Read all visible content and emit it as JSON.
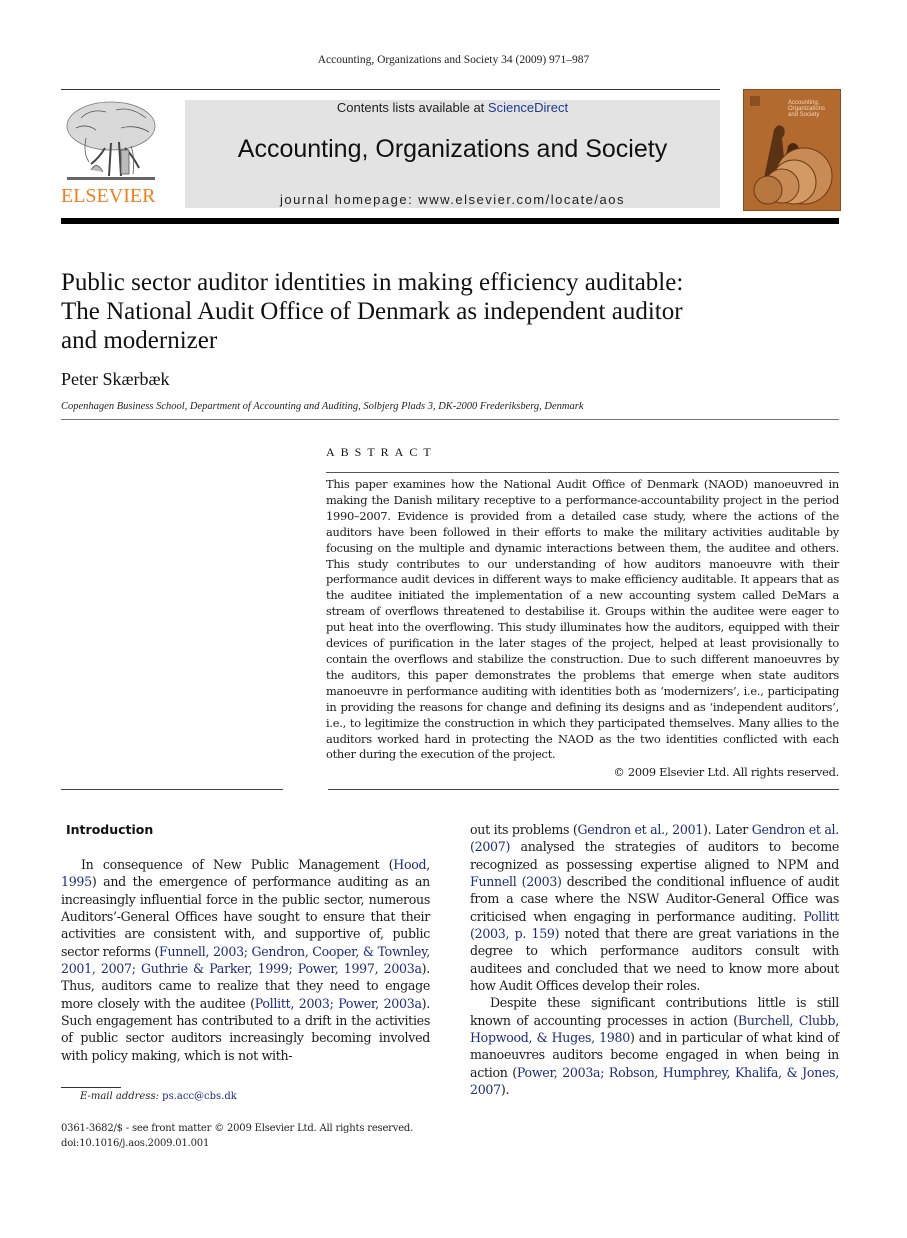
{
  "running_head": "Accounting, Organizations and Society 34 (2009) 971–987",
  "header": {
    "publisher_logo_text": "ELSEVIER",
    "contents_prefix": "Contents lists available at ",
    "contents_link": "ScienceDirect",
    "journal_title": "Accounting, Organizations and Society",
    "homepage": "journal homepage: www.elsevier.com/locate/aos",
    "cover_title": "Accounting, Organizations and Society",
    "colors": {
      "elsevier_orange": "#f07f1b",
      "banner_gray": "#e3e3e3",
      "cover_brown": "#b26a2e",
      "link_blue": "#1d2a80"
    }
  },
  "article": {
    "title_lines": [
      "Public sector auditor identities in making efficiency auditable:",
      "The National Audit Office of Denmark as independent auditor",
      "and modernizer"
    ],
    "author": "Peter Skærbæk",
    "affiliation": "Copenhagen Business School, Department of Accounting and Auditing, Solbjerg Plads 3, DK-2000 Frederiksberg, Denmark"
  },
  "abstract": {
    "heading": "ABSTRACT",
    "text": "This paper examines how the National Audit Office of Denmark (NAOD) manoeuvred in making the Danish military receptive to a performance-accountability project in the period 1990–2007. Evidence is provided from a detailed case study, where the actions of the auditors have been followed in their efforts to make the military activities auditable by focusing on the multiple and dynamic interactions between them, the auditee and others. This study contributes to our understanding of how auditors manoeuvre with their performance audit devices in different ways to make efficiency auditable. It appears that as the auditee initiated the implementation of a new accounting system called DeMars a stream of overflows threatened to destabilise it. Groups within the auditee were eager to put heat into the overflowing. This study illuminates how the auditors, equipped with their devices of purification in the later stages of the project, helped at least provisionally to contain the overflows and stabilize the construction. Due to such different manoeuvres by the auditors, this paper demonstrates the problems that emerge when state auditors manoeuvre in performance auditing with identities both as ‘modernizers’, i.e., participating in providing the reasons for change and defining its designs and as ‘independent auditors’, i.e., to legitimize the construction in which they participated themselves. Many allies to the auditors worked hard in protecting the NAOD as the two identities conflicted with each other during the execution of the project.",
    "copyright": "© 2009 Elsevier Ltd. All rights reserved."
  },
  "introduction": {
    "heading": "Introduction",
    "left_column": [
      {
        "t": "In consequence of New Public Management ("
      },
      {
        "t": "Hood, 1995",
        "cite": true
      },
      {
        "t": ") and the emergence of performance auditing as an increasingly influential force in the public sector, numerous Auditors’-General Offices have sought to ensure that their activities are consistent with, and supportive of, public sector reforms ("
      },
      {
        "t": "Funnell, 2003; Gendron, Cooper, & Townley, 2001, 2007; Guthrie & Parker, 1999; Power, 1997, 2003a",
        "cite": true
      },
      {
        "t": "). Thus, auditors came to realize that they need to engage more closely with the auditee ("
      },
      {
        "t": "Pollitt, 2003; Power, 2003a",
        "cite": true
      },
      {
        "t": "). Such engagement has contributed to a drift in the activities of public sector auditors increasingly becoming involved with policy making, which is not with-"
      }
    ],
    "right_column_p1": [
      {
        "t": "out its problems ("
      },
      {
        "t": "Gendron et al., 2001",
        "cite": true
      },
      {
        "t": "). Later "
      },
      {
        "t": "Gendron et al. (2007)",
        "cite": true
      },
      {
        "t": " analysed the strategies of auditors to become recognized as possessing expertise aligned to NPM and "
      },
      {
        "t": "Funnell (2003)",
        "cite": true
      },
      {
        "t": " described the conditional influence of audit from a case where the NSW Auditor-General Office was criticised when engaging in performance auditing. "
      },
      {
        "t": "Pollitt (2003, p. 159)",
        "cite": true
      },
      {
        "t": " noted that there are great variations in the degree to which performance auditors consult with auditees and concluded that we need to know more about how Audit Offices develop their roles."
      }
    ],
    "right_column_p2": [
      {
        "t": "Despite these significant contributions little is still known of accounting processes in action ("
      },
      {
        "t": "Burchell, Clubb, Hopwood, & Huges, 1980",
        "cite": true
      },
      {
        "t": ") and in particular of what kind of manoeuvres auditors become engaged in when being in action ("
      },
      {
        "t": "Power, 2003a; Robson, Humphrey, Khalifa, & Jones, 2007",
        "cite": true
      },
      {
        "t": ")."
      }
    ]
  },
  "footnote": {
    "email_label": "E-mail address:",
    "email": "ps.acc@cbs.dk"
  },
  "front_matter": {
    "issn_line": "0361-3682/$ - see front matter © 2009 Elsevier Ltd. All rights reserved.",
    "doi": "doi:10.1016/j.aos.2009.01.001"
  }
}
